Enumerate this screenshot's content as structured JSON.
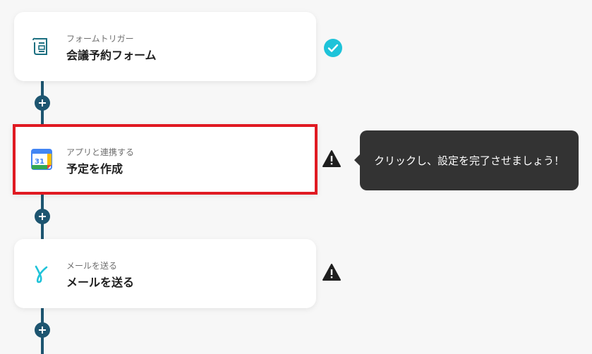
{
  "flow": {
    "steps": [
      {
        "subtitle": "フォームトリガー",
        "title": "会議予約フォーム",
        "icon": "form-icon",
        "status": "completed"
      },
      {
        "subtitle": "アプリと連携する",
        "title": "予定を作成",
        "icon": "google-calendar-icon",
        "status": "warning"
      },
      {
        "subtitle": "メールを送る",
        "title": "メールを送る",
        "icon": "yoom-mail-icon",
        "status": "warning"
      }
    ],
    "calendar_day": "31"
  },
  "tooltip": {
    "text": "クリックし、設定を完了させましょう！"
  },
  "colors": {
    "connector": "#1d5570",
    "check": "#1ec3d9",
    "highlight": "#e01a22",
    "tooltip_bg": "#333333"
  }
}
